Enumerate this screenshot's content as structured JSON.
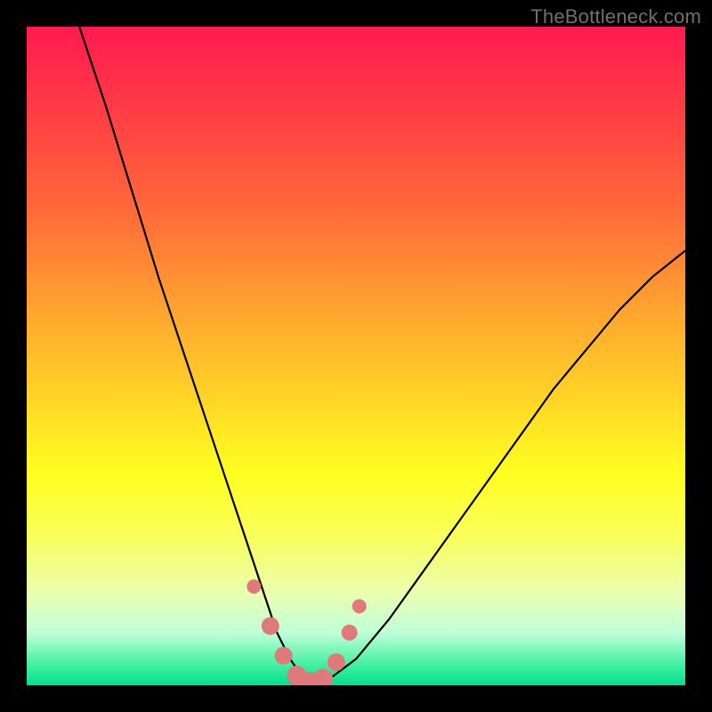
{
  "watermark": "TheBottleneck.com",
  "chart_data": {
    "type": "line",
    "title": "",
    "xlabel": "",
    "ylabel": "",
    "xlim": [
      0,
      100
    ],
    "ylim": [
      0,
      100
    ],
    "curve": {
      "x": [
        8,
        12,
        16,
        20,
        24,
        28,
        32,
        34,
        36,
        38,
        40,
        42,
        44,
        46,
        50,
        55,
        60,
        65,
        70,
        75,
        80,
        85,
        90,
        95,
        100
      ],
      "y": [
        100,
        88,
        75,
        62,
        50,
        38,
        26,
        20,
        14,
        8,
        4,
        1,
        0,
        1,
        4,
        10,
        17,
        24,
        31,
        38,
        45,
        51,
        57,
        62,
        66
      ]
    },
    "markers": {
      "x": [
        34.5,
        37,
        39,
        41,
        43,
        45,
        47,
        49,
        50.5
      ],
      "y": [
        15,
        9,
        4.5,
        1.5,
        0.5,
        1,
        3.5,
        8,
        12
      ],
      "r": [
        8,
        10,
        10,
        11,
        11,
        11,
        10,
        9,
        8
      ]
    },
    "colors": {
      "curve": "#000000",
      "marker": "#e07a7a"
    }
  }
}
